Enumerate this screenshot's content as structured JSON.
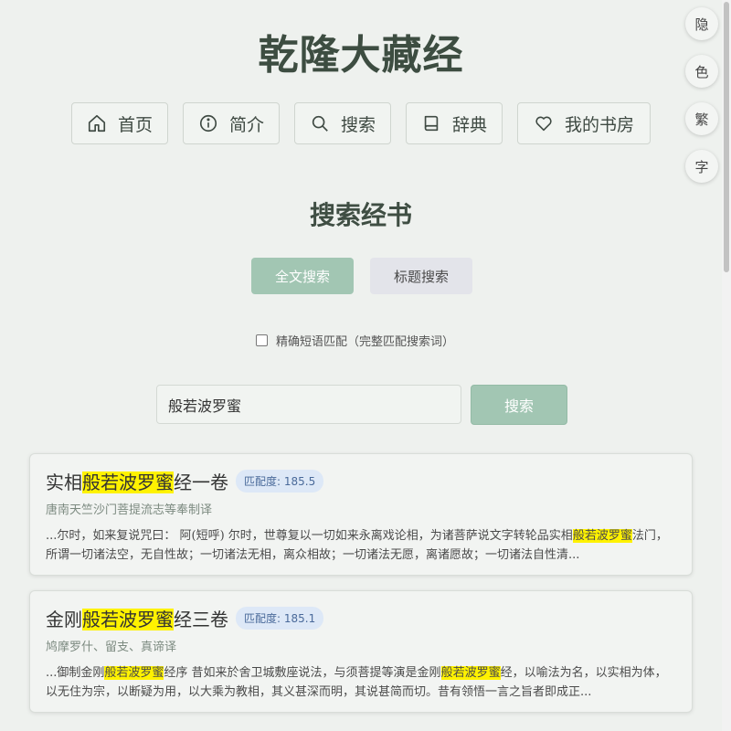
{
  "app": {
    "title": "乾隆大藏经"
  },
  "nav": {
    "home": "首页",
    "intro": "简介",
    "search": "搜索",
    "dict": "辞典",
    "shelf": "我的书房"
  },
  "side": {
    "hide": "隐",
    "color": "色",
    "traditional": "繁",
    "font": "字"
  },
  "search_section": {
    "title": "搜索经书",
    "mode_full": "全文搜索",
    "mode_title": "标题搜索",
    "exact_label": "精确短语匹配（完整匹配搜索词）",
    "exact_checked": false,
    "query": "般若波罗蜜",
    "button": "搜索"
  },
  "results": [
    {
      "title_pre": "实相",
      "title_hl": "般若波罗蜜",
      "title_post": "经一卷",
      "score": "匹配度: 185.5",
      "translator": "唐南天竺沙门菩提流志等奉制译",
      "snippet_pre": "...尔时，如来复说咒曰： 阿(短呼) 尔时，世尊复以一切如来永离戏论相，为诸菩萨说文字转轮品实相",
      "snippet_hl": "般若波罗蜜",
      "snippet_post": "法门，所谓一切诸法空，无自性故；一切诸法无相，离众相故；一切诸法无愿，离诸愿故；一切诸法自性清..."
    },
    {
      "title_pre": "金刚",
      "title_hl": "般若波罗蜜",
      "title_post": "经三卷",
      "score": "匹配度: 185.1",
      "translator": "鸠摩罗什、留支、真谛译",
      "snippet_pre": "...御制金刚",
      "snippet_hl": "般若波罗蜜",
      "snippet_mid": "经序 昔如来於舍卫城敷座说法，与须菩提等演是金刚",
      "snippet_hl2": "般若波罗蜜",
      "snippet_post": "经，以喻法为名，以实相为体，以无住为宗，以断疑为用，以大乘为教相，其义甚深而明，其说甚简而切。昔有领悟一言之旨者即成正..."
    }
  ]
}
